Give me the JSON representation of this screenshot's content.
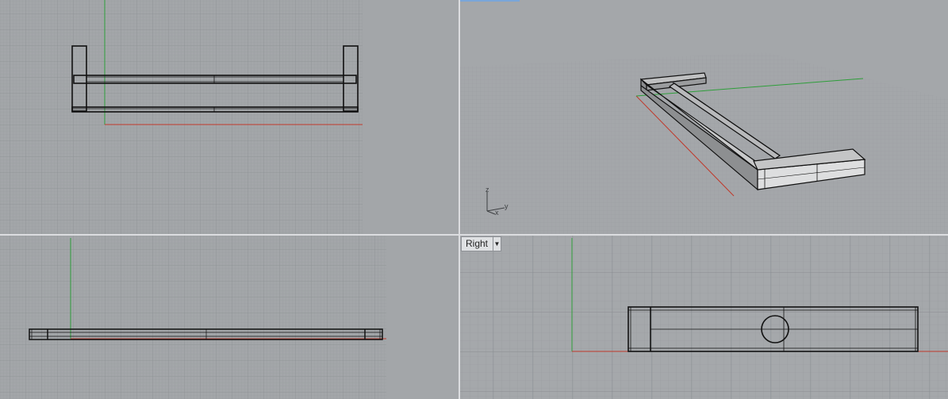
{
  "viewports": {
    "top": {
      "label": ""
    },
    "perspective": {
      "label": "",
      "gizmo": {
        "z": "z",
        "y": "y",
        "x": "x"
      }
    },
    "front": {
      "label": ""
    },
    "right": {
      "label": "Right",
      "menu_icon": "triangle-down"
    }
  },
  "colors": {
    "viewport_bg": "#a3a6a9",
    "grid_line": "#999ca0",
    "grid_major": "#8d9094",
    "x_axis": "#c0392b",
    "y_axis": "#2e9e3a",
    "edge": "#111111",
    "divider": "#dcdde0"
  }
}
